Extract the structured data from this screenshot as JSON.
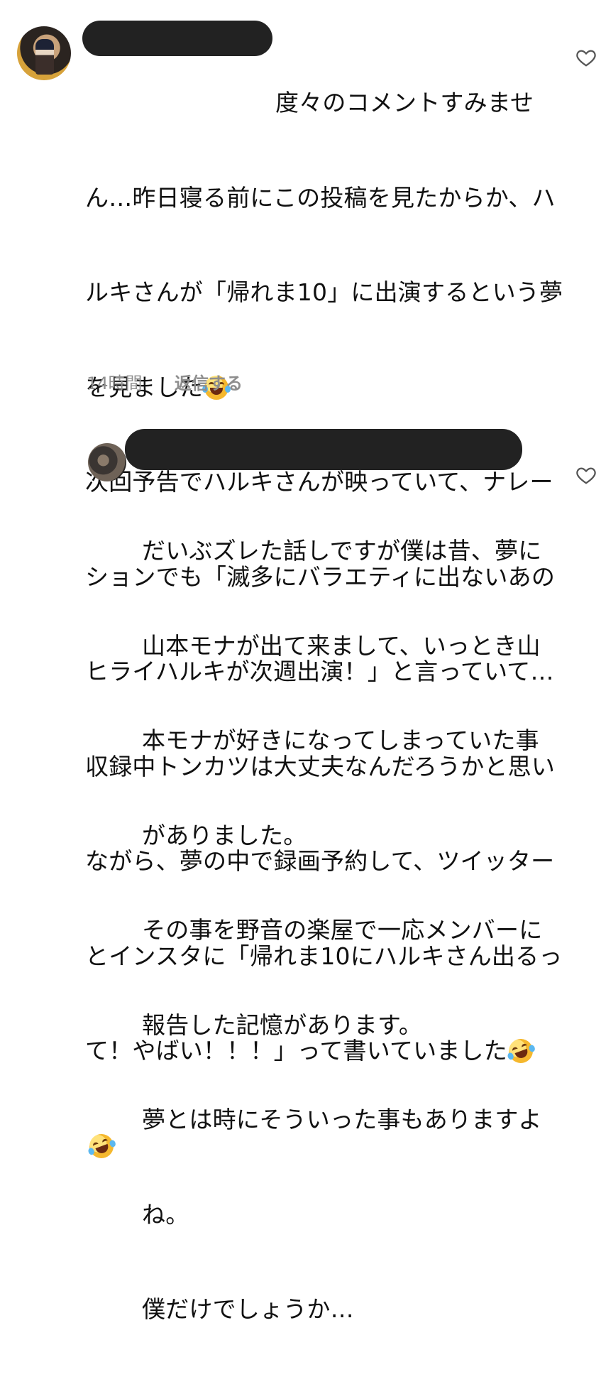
{
  "comment1": {
    "avatar_icon": "user-avatar-photo",
    "lines": [
      "度々のコメントすみませ",
      "ん…昨日寝る前にこの投稿を見たからか、ハ",
      "ルキさんが「帰れま10」に出演するという夢",
      "を見ました",
      "次回予告でハルキさんが映っていて、ナレー",
      "ションでも「滅多にバラエティに出ないあの",
      "ヒライハルキが次週出演！」と言っていて…",
      "収録中トンカツは大丈夫なんだろうかと思い",
      "ながら、夢の中で録画予約して、ツイッター",
      "とインスタに「帰れま10にハルキさん出るっ",
      "て！やばい！！！」って書いていました",
      ""
    ],
    "emojis": [
      "face-with-tears-of-joy",
      "rolling-on-the-floor-laughing",
      "rolling-on-the-floor-laughing"
    ],
    "time": "14時間",
    "reply_label": "返信する",
    "like_icon": "heart-outline-icon"
  },
  "comment2": {
    "avatar_icon": "user-avatar-photo",
    "lines": [
      "だいぶズレた話しですが僕は昔、夢に",
      "山本モナが出て来まして、いっとき山",
      "本モナが好きになってしまっていた事",
      "がありました。",
      "その事を野音の楽屋で一応メンバーに",
      "報告した記憶があります。",
      "夢とは時にそういった事もありますよ",
      "ね。",
      "僕だけでしょうか…"
    ],
    "like_icon": "heart-outline-icon"
  }
}
